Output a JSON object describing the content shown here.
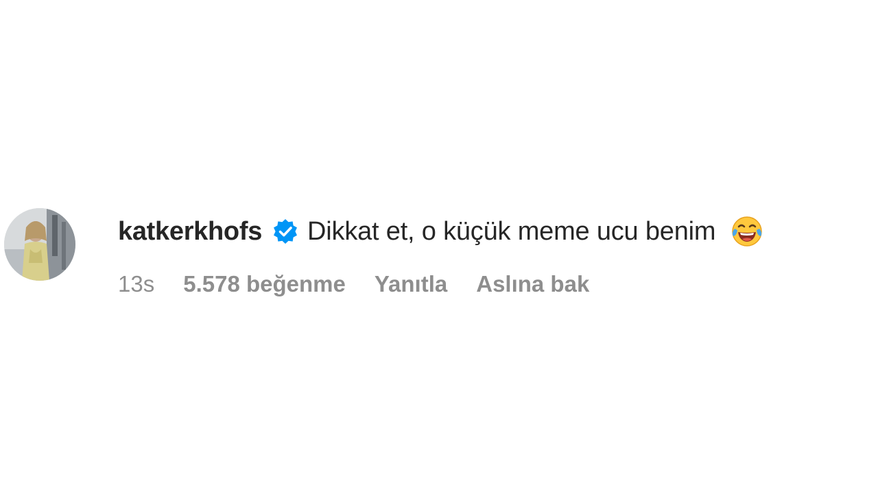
{
  "comment": {
    "username": "katkerkhofs",
    "verified": true,
    "text": "Dikkat et, o küçük meme ucu benim",
    "emoji": "face-with-tears-of-joy-icon",
    "time": "13s",
    "likes": "5.578 beğenme",
    "reply_label": "Yanıtla",
    "translate_label": "Aslına bak"
  },
  "colors": {
    "text": "#262626",
    "muted": "#8e8e8e",
    "verified_blue": "#0095f6",
    "background": "#ffffff"
  }
}
